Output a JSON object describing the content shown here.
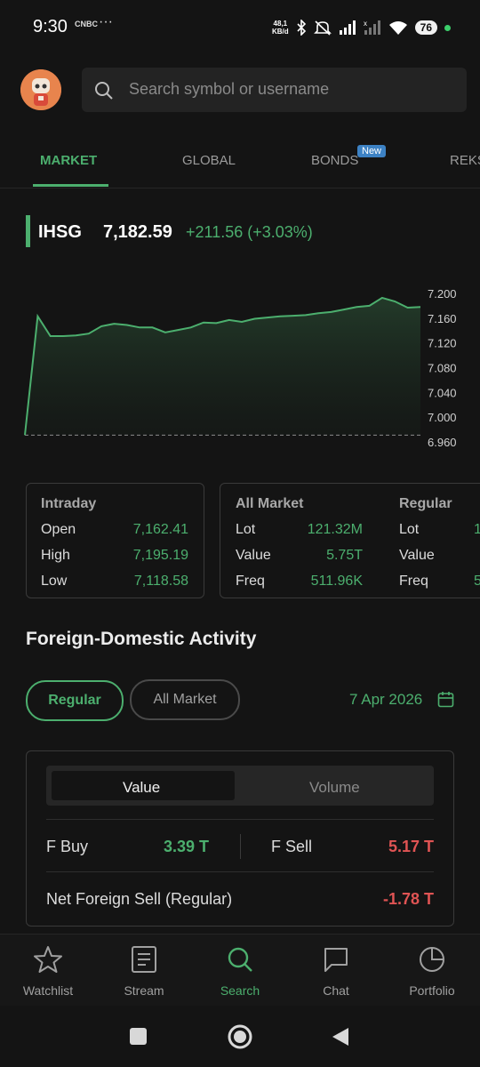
{
  "status_bar": {
    "time": "9:30",
    "carrier_badge": "CNBC",
    "dots": "···",
    "net_speed_value": "48,1",
    "net_speed_unit": "KB/d",
    "battery": "76"
  },
  "search": {
    "placeholder": "Search symbol or username"
  },
  "tabs": [
    {
      "label": "MARKET",
      "active": true
    },
    {
      "label": "GLOBAL",
      "active": false
    },
    {
      "label": "BONDS",
      "active": false,
      "badge": "New"
    },
    {
      "label": "REKS",
      "active": false
    }
  ],
  "index": {
    "name": "IHSG",
    "value": "7,182.59",
    "change": "+211.56 (+3.03%)"
  },
  "chart_data": {
    "type": "area",
    "title": "",
    "xlabel": "",
    "ylabel": "",
    "ylim": [
      6960,
      7210
    ],
    "y_ticks": [
      "7.200",
      "7.160",
      "7.120",
      "7.080",
      "7.040",
      "7.000",
      "6.960"
    ],
    "baseline": 6971,
    "values": [
      6971,
      7163,
      7131,
      7131,
      7132,
      7135,
      7147,
      7151,
      7149,
      7145,
      7145,
      7137,
      7141,
      7145,
      7153,
      7152,
      7157,
      7154,
      7159,
      7161,
      7163,
      7164,
      7165,
      7168,
      7170,
      7174,
      7178,
      7180,
      7193,
      7187,
      7177,
      7178
    ],
    "line_color": "#4caf6e"
  },
  "intraday": {
    "title": "Intraday",
    "rows": [
      {
        "label": "Open",
        "value": "7,162.41"
      },
      {
        "label": "High",
        "value": "7,195.19"
      },
      {
        "label": "Low",
        "value": "7,118.58"
      }
    ]
  },
  "all_market": {
    "title": "All Market",
    "rows": [
      {
        "label": "Lot",
        "value": "121.32M"
      },
      {
        "label": "Value",
        "value": "5.75T"
      },
      {
        "label": "Freq",
        "value": "511.96K"
      }
    ]
  },
  "regular": {
    "title": "Regular",
    "rows": [
      {
        "label": "Lot",
        "value": "1"
      },
      {
        "label": "Value",
        "value": ""
      },
      {
        "label": "Freq",
        "value": "5"
      }
    ]
  },
  "foreign_domestic": {
    "title": "Foreign-Domestic Activity",
    "pill_regular": "Regular",
    "pill_all_market": "All Market",
    "date": "7 Apr 2026",
    "seg_value": "Value",
    "seg_volume": "Volume",
    "f_buy_label": "F Buy",
    "f_buy_value": "3.39 T",
    "f_sell_label": "F Sell",
    "f_sell_value": "5.17 T",
    "net_label": "Net Foreign Sell (Regular)",
    "net_value": "-1.78 T"
  },
  "bottom_nav": [
    {
      "label": "Watchlist",
      "icon": "star-icon"
    },
    {
      "label": "Stream",
      "icon": "stream-icon"
    },
    {
      "label": "Search",
      "icon": "search-icon",
      "active": true
    },
    {
      "label": "Chat",
      "icon": "chat-icon"
    },
    {
      "label": "Portfolio",
      "icon": "pie-chart-icon"
    }
  ],
  "colors": {
    "accent": "#4caf6e",
    "negative": "#e05454",
    "background": "#141414"
  }
}
